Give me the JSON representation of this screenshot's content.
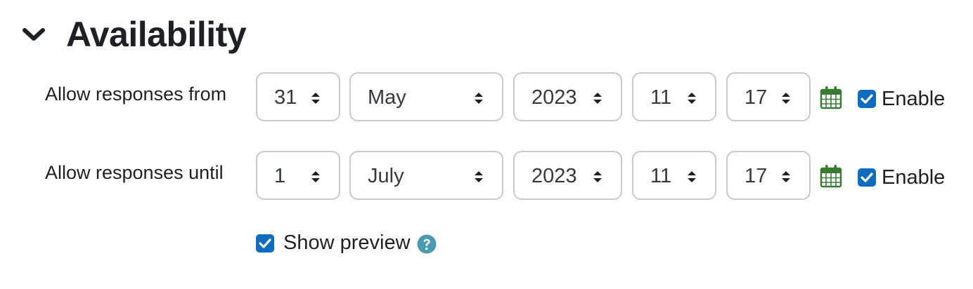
{
  "section": {
    "title": "Availability",
    "expanded": true
  },
  "rows": [
    {
      "label": "Allow responses from",
      "day": "31",
      "month": "May",
      "year": "2023",
      "hour": "11",
      "minute": "17",
      "enable_label": "Enable",
      "enabled": true
    },
    {
      "label": "Allow responses until",
      "day": "1",
      "month": "July",
      "year": "2023",
      "hour": "11",
      "minute": "17",
      "enable_label": "Enable",
      "enabled": true
    }
  ],
  "preview": {
    "label": "Show preview",
    "checked": true
  },
  "colors": {
    "accent": "#0f6cbf",
    "calendar": "#3a7b34",
    "help": "#4a9bb0",
    "border": "#c6c9cf"
  }
}
